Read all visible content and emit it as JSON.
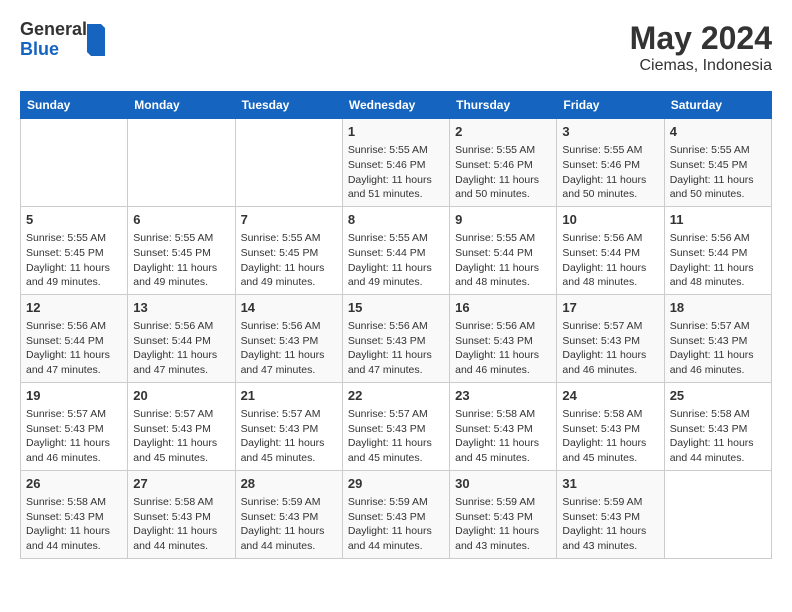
{
  "header": {
    "logo_general": "General",
    "logo_blue": "Blue",
    "title": "May 2024",
    "subtitle": "Ciemas, Indonesia"
  },
  "days_of_week": [
    "Sunday",
    "Monday",
    "Tuesday",
    "Wednesday",
    "Thursday",
    "Friday",
    "Saturday"
  ],
  "weeks": [
    [
      {
        "num": "",
        "info": ""
      },
      {
        "num": "",
        "info": ""
      },
      {
        "num": "",
        "info": ""
      },
      {
        "num": "1",
        "info": "Sunrise: 5:55 AM\nSunset: 5:46 PM\nDaylight: 11 hours\nand 51 minutes."
      },
      {
        "num": "2",
        "info": "Sunrise: 5:55 AM\nSunset: 5:46 PM\nDaylight: 11 hours\nand 50 minutes."
      },
      {
        "num": "3",
        "info": "Sunrise: 5:55 AM\nSunset: 5:46 PM\nDaylight: 11 hours\nand 50 minutes."
      },
      {
        "num": "4",
        "info": "Sunrise: 5:55 AM\nSunset: 5:45 PM\nDaylight: 11 hours\nand 50 minutes."
      }
    ],
    [
      {
        "num": "5",
        "info": "Sunrise: 5:55 AM\nSunset: 5:45 PM\nDaylight: 11 hours\nand 49 minutes."
      },
      {
        "num": "6",
        "info": "Sunrise: 5:55 AM\nSunset: 5:45 PM\nDaylight: 11 hours\nand 49 minutes."
      },
      {
        "num": "7",
        "info": "Sunrise: 5:55 AM\nSunset: 5:45 PM\nDaylight: 11 hours\nand 49 minutes."
      },
      {
        "num": "8",
        "info": "Sunrise: 5:55 AM\nSunset: 5:44 PM\nDaylight: 11 hours\nand 49 minutes."
      },
      {
        "num": "9",
        "info": "Sunrise: 5:55 AM\nSunset: 5:44 PM\nDaylight: 11 hours\nand 48 minutes."
      },
      {
        "num": "10",
        "info": "Sunrise: 5:56 AM\nSunset: 5:44 PM\nDaylight: 11 hours\nand 48 minutes."
      },
      {
        "num": "11",
        "info": "Sunrise: 5:56 AM\nSunset: 5:44 PM\nDaylight: 11 hours\nand 48 minutes."
      }
    ],
    [
      {
        "num": "12",
        "info": "Sunrise: 5:56 AM\nSunset: 5:44 PM\nDaylight: 11 hours\nand 47 minutes."
      },
      {
        "num": "13",
        "info": "Sunrise: 5:56 AM\nSunset: 5:44 PM\nDaylight: 11 hours\nand 47 minutes."
      },
      {
        "num": "14",
        "info": "Sunrise: 5:56 AM\nSunset: 5:43 PM\nDaylight: 11 hours\nand 47 minutes."
      },
      {
        "num": "15",
        "info": "Sunrise: 5:56 AM\nSunset: 5:43 PM\nDaylight: 11 hours\nand 47 minutes."
      },
      {
        "num": "16",
        "info": "Sunrise: 5:56 AM\nSunset: 5:43 PM\nDaylight: 11 hours\nand 46 minutes."
      },
      {
        "num": "17",
        "info": "Sunrise: 5:57 AM\nSunset: 5:43 PM\nDaylight: 11 hours\nand 46 minutes."
      },
      {
        "num": "18",
        "info": "Sunrise: 5:57 AM\nSunset: 5:43 PM\nDaylight: 11 hours\nand 46 minutes."
      }
    ],
    [
      {
        "num": "19",
        "info": "Sunrise: 5:57 AM\nSunset: 5:43 PM\nDaylight: 11 hours\nand 46 minutes."
      },
      {
        "num": "20",
        "info": "Sunrise: 5:57 AM\nSunset: 5:43 PM\nDaylight: 11 hours\nand 45 minutes."
      },
      {
        "num": "21",
        "info": "Sunrise: 5:57 AM\nSunset: 5:43 PM\nDaylight: 11 hours\nand 45 minutes."
      },
      {
        "num": "22",
        "info": "Sunrise: 5:57 AM\nSunset: 5:43 PM\nDaylight: 11 hours\nand 45 minutes."
      },
      {
        "num": "23",
        "info": "Sunrise: 5:58 AM\nSunset: 5:43 PM\nDaylight: 11 hours\nand 45 minutes."
      },
      {
        "num": "24",
        "info": "Sunrise: 5:58 AM\nSunset: 5:43 PM\nDaylight: 11 hours\nand 45 minutes."
      },
      {
        "num": "25",
        "info": "Sunrise: 5:58 AM\nSunset: 5:43 PM\nDaylight: 11 hours\nand 44 minutes."
      }
    ],
    [
      {
        "num": "26",
        "info": "Sunrise: 5:58 AM\nSunset: 5:43 PM\nDaylight: 11 hours\nand 44 minutes."
      },
      {
        "num": "27",
        "info": "Sunrise: 5:58 AM\nSunset: 5:43 PM\nDaylight: 11 hours\nand 44 minutes."
      },
      {
        "num": "28",
        "info": "Sunrise: 5:59 AM\nSunset: 5:43 PM\nDaylight: 11 hours\nand 44 minutes."
      },
      {
        "num": "29",
        "info": "Sunrise: 5:59 AM\nSunset: 5:43 PM\nDaylight: 11 hours\nand 44 minutes."
      },
      {
        "num": "30",
        "info": "Sunrise: 5:59 AM\nSunset: 5:43 PM\nDaylight: 11 hours\nand 43 minutes."
      },
      {
        "num": "31",
        "info": "Sunrise: 5:59 AM\nSunset: 5:43 PM\nDaylight: 11 hours\nand 43 minutes."
      },
      {
        "num": "",
        "info": ""
      }
    ]
  ]
}
